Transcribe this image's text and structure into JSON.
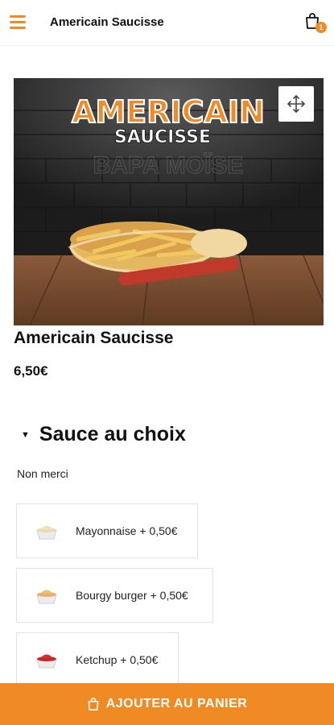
{
  "header": {
    "title": "Americain Saucisse",
    "menu_icon": "hamburger-icon",
    "cart_icon": "shopping-bag-icon",
    "cart_count": "1"
  },
  "hero": {
    "title_line1": "AMERICAIN",
    "title_line2": "SAUCISSE",
    "watermark": "BAPA MOÏSE",
    "expand_icon": "move-arrows-icon"
  },
  "product": {
    "name": "Americain Saucisse",
    "price": "6,50€"
  },
  "section": {
    "title": "Sauce au choix",
    "none_option": "Non merci",
    "options": [
      {
        "label": "Mayonnaise + 0,50€",
        "icon": "mayonnaise-cup-icon"
      },
      {
        "label": "Bourgy burger + 0,50€",
        "icon": "burger-sauce-cup-icon"
      },
      {
        "label": "Ketchup + 0,50€",
        "icon": "ketchup-cup-icon"
      }
    ]
  },
  "cta": {
    "label": "AJOUTER AU PANIER",
    "icon": "shopping-bag-icon"
  },
  "colors": {
    "accent": "#f08a24",
    "text": "#111111",
    "border": "#e2e2e2"
  }
}
